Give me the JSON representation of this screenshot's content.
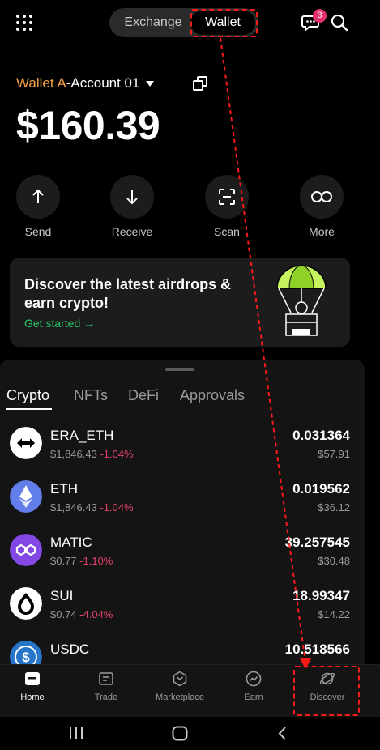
{
  "header": {
    "segments": [
      "Exchange",
      "Wallet"
    ],
    "active_segment": "Wallet",
    "notification_count": "3"
  },
  "account": {
    "wallet_name": "Wallet A",
    "separator": "-",
    "account_name": "Account 01",
    "balance": "$160.39"
  },
  "actions": [
    {
      "label": "Send",
      "icon": "arrow-up-icon"
    },
    {
      "label": "Receive",
      "icon": "arrow-down-icon"
    },
    {
      "label": "Scan",
      "icon": "scan-icon"
    },
    {
      "label": "More",
      "icon": "infinity-icon"
    }
  ],
  "promo": {
    "title": "Discover the latest airdrops & earn crypto!",
    "cta": "Get started",
    "cta_arrow": "→"
  },
  "tabs": [
    "Crypto",
    "NFTs",
    "DeFi",
    "Approvals"
  ],
  "active_tab": "Crypto",
  "tokens": [
    {
      "symbol": "ERA_ETH",
      "price": "$1,846.43",
      "change": "-1.04%",
      "amount": "0.031364",
      "value": "$57.91",
      "icon": "era-icon"
    },
    {
      "symbol": "ETH",
      "price": "$1,846.43",
      "change": "-1.04%",
      "amount": "0.019562",
      "value": "$36.12",
      "icon": "eth-icon"
    },
    {
      "symbol": "MATIC",
      "price": "$0.77",
      "change": "-1.10%",
      "amount": "39.257545",
      "value": "$30.48",
      "icon": "matic-icon"
    },
    {
      "symbol": "SUI",
      "price": "$0.74",
      "change": "-4.04%",
      "amount": "18.99347",
      "value": "$14.22",
      "icon": "sui-icon"
    },
    {
      "symbol": "USDC",
      "price": "",
      "change": "",
      "amount": "10.518566",
      "value": "",
      "icon": "usdc-icon"
    }
  ],
  "bottom_nav": [
    {
      "label": "Home",
      "icon": "home-icon",
      "active": true
    },
    {
      "label": "Trade",
      "icon": "trade-icon",
      "active": false
    },
    {
      "label": "Marketplace",
      "icon": "marketplace-icon",
      "active": false
    },
    {
      "label": "Earn",
      "icon": "earn-icon",
      "active": false
    },
    {
      "label": "Discover",
      "icon": "discover-icon",
      "active": false
    }
  ],
  "colors": {
    "accent_orange": "#f5a243",
    "positive_green": "#25c86a",
    "negative_red": "#e2426b",
    "annotation_red": "#ff1a1a",
    "badge_pink": "#e2336b"
  }
}
